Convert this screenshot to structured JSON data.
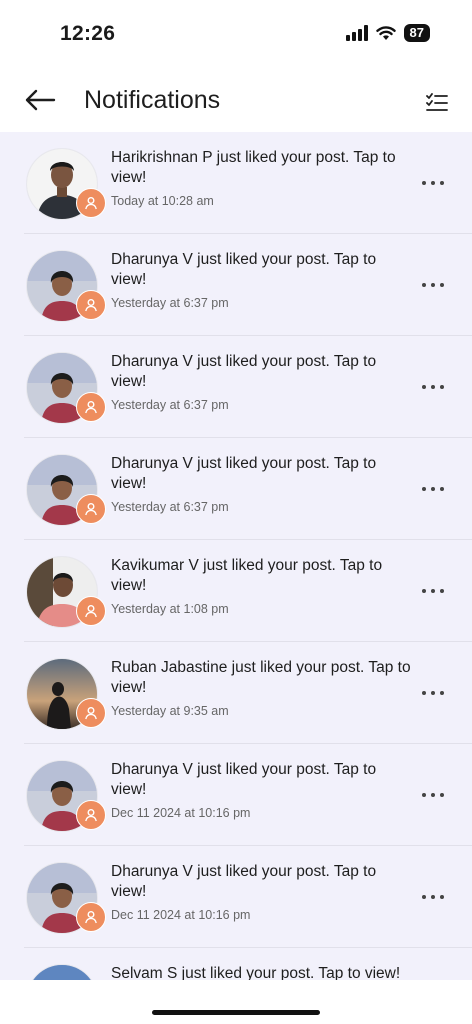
{
  "status": {
    "time": "12:26",
    "battery": "87"
  },
  "header": {
    "title": "Notifications",
    "back_icon": "arrow-left-icon",
    "filter_icon": "checklist-icon"
  },
  "notifications": [
    {
      "message": "Harikrishnan P just liked your post. Tap to view!",
      "time": "Today at 10:28 am",
      "avatar": "harikrishnan"
    },
    {
      "message": "Dharunya V just liked your post. Tap to view!",
      "time": "Yesterday at 6:37 pm",
      "avatar": "dharunya"
    },
    {
      "message": "Dharunya V just liked your post. Tap to view!",
      "time": "Yesterday at 6:37 pm",
      "avatar": "dharunya"
    },
    {
      "message": "Dharunya V just liked your post. Tap to view!",
      "time": "Yesterday at 6:37 pm",
      "avatar": "dharunya"
    },
    {
      "message": "Kavikumar V just liked your post. Tap to view!",
      "time": "Yesterday at 1:08 pm",
      "avatar": "kavikumar"
    },
    {
      "message": "Ruban Jabastine just liked your post. Tap to view!",
      "time": "Yesterday at 9:35 am",
      "avatar": "ruban"
    },
    {
      "message": "Dharunya V just liked your post. Tap to view!",
      "time": "Dec 11 2024 at 10:16 pm",
      "avatar": "dharunya"
    },
    {
      "message": "Dharunya V just liked your post. Tap to view!",
      "time": "Dec 11 2024 at 10:16 pm",
      "avatar": "dharunya"
    },
    {
      "message": "Selvam S just liked your post. Tap to view!",
      "time": "",
      "avatar": "selvam"
    }
  ],
  "colors": {
    "badge": "#ee8d5e",
    "list_bg": "#f2f1fb"
  }
}
